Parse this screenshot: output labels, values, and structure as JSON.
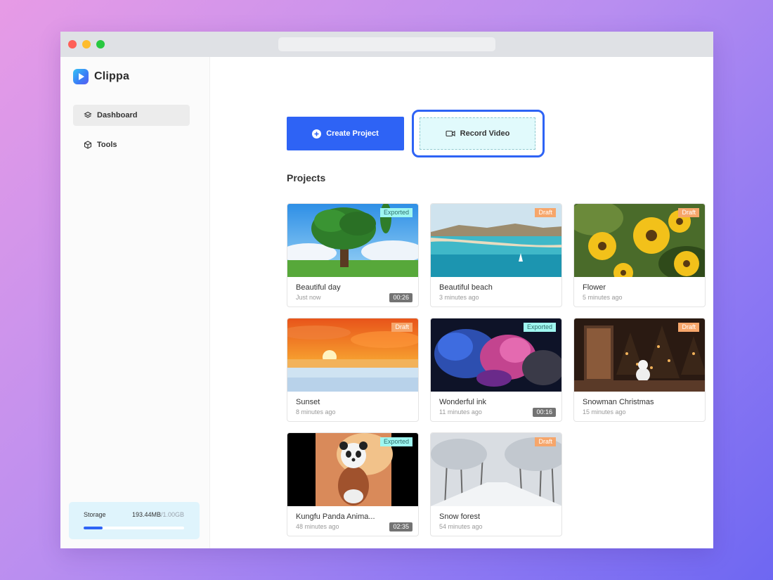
{
  "brand": {
    "name": "Clippa"
  },
  "sidebar": {
    "items": [
      {
        "label": "Dashboard",
        "icon": "layers-icon",
        "active": true
      },
      {
        "label": "Tools",
        "icon": "cube-icon",
        "active": false
      }
    ]
  },
  "storage": {
    "label": "Storage",
    "used": "193.44MB",
    "total": "/1.00GB",
    "fraction": 0.19
  },
  "actions": {
    "create_label": "Create Project",
    "record_label": "Record Video"
  },
  "projects": {
    "title": "Projects",
    "items": [
      {
        "title": "Beautiful day",
        "time": "Just now",
        "status": "Exported",
        "duration": "00:26"
      },
      {
        "title": "Beautiful beach",
        "time": "3 minutes ago",
        "status": "Draft",
        "duration": ""
      },
      {
        "title": "Flower",
        "time": "5 minutes ago",
        "status": "Draft",
        "duration": ""
      },
      {
        "title": "Sunset",
        "time": "8 minutes ago",
        "status": "Draft",
        "duration": ""
      },
      {
        "title": "Wonderful ink",
        "time": "11 minutes ago",
        "status": "Exported",
        "duration": "00:16"
      },
      {
        "title": "Snowman Christmas",
        "time": "15 minutes ago",
        "status": "Draft",
        "duration": ""
      },
      {
        "title": "Kungfu Panda Anima...",
        "time": "48 minutes ago",
        "status": "Exported",
        "duration": "02:35"
      },
      {
        "title": "Snow forest",
        "time": "54 minutes ago",
        "status": "Draft",
        "duration": ""
      }
    ]
  },
  "colors": {
    "accent": "#2e63f5",
    "exported_badge": "#9ff7f1",
    "draft_badge": "#f6a66b",
    "record_bg": "#e1fafc",
    "storage_bg": "#dff4fc"
  }
}
